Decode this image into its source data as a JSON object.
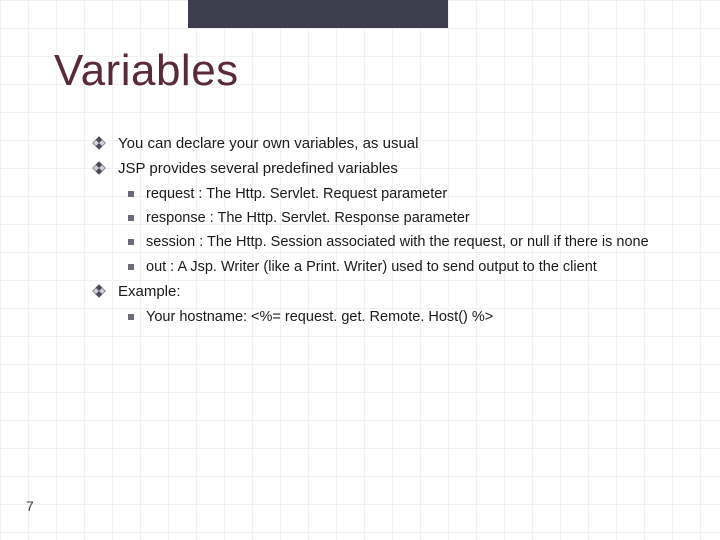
{
  "slide": {
    "title": "Variables",
    "bullets": [
      {
        "text": "You can declare your own variables, as usual"
      },
      {
        "text": "JSP provides several predefined variables",
        "sub": [
          "request : The Http. Servlet. Request parameter",
          "response : The Http. Servlet. Response parameter",
          "session : The Http. Session associated with the request, or null if there is none",
          "out : A Jsp. Writer (like a Print. Writer) used to send output to the client"
        ]
      },
      {
        "text": "Example:",
        "sub": [
          "Your hostname: <%= request. get. Remote. Host() %>"
        ]
      }
    ],
    "page_number": "7"
  }
}
